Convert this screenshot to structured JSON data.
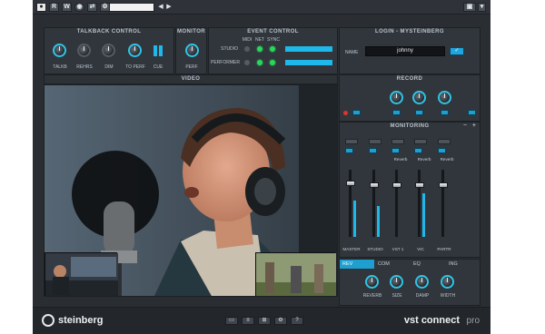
{
  "topbar": {
    "buttons": [
      "R",
      "W"
    ],
    "nav_arrows": [
      "◀",
      "▶"
    ],
    "right_icon": "camera-icon"
  },
  "talkback": {
    "title": "TALKBACK CONTROL",
    "labels": [
      "TALKB",
      "REHRS",
      "DIM",
      "TO PERF",
      "CUE"
    ]
  },
  "monitor": {
    "title": "MONITOR",
    "label": "PERF"
  },
  "event": {
    "title": "EVENT CONTROL",
    "columns": [
      "MIDI",
      "NET",
      "SYNC"
    ],
    "rows": [
      "STUDIO",
      "PERFORMER"
    ]
  },
  "login": {
    "title": "LOGIN - MYSTEINBERG",
    "name_label": "NAME",
    "name_value": "johnny"
  },
  "video": {
    "title": "VIDEO"
  },
  "record": {
    "title": "RECORD"
  },
  "monitoring": {
    "title": "MONITORING",
    "sends": [
      "Reverb",
      "Reverb",
      "Reverb"
    ],
    "channels": [
      "MASTER",
      "STUDIO",
      "VST 1",
      "VIC",
      "PARTR"
    ]
  },
  "effects": {
    "tabs": [
      "REV",
      "COM",
      "EQ",
      "ING"
    ],
    "knobs": [
      "REVERB",
      "SIZE",
      "DAMP",
      "WIDTH"
    ]
  },
  "brand": {
    "logo": "steinberg",
    "product": "vst connect",
    "edition": "pro"
  },
  "colors": {
    "accent": "#1fb8ea",
    "led_on": "#27d85a",
    "panel": "#31363c",
    "background": "#2a2e33"
  }
}
